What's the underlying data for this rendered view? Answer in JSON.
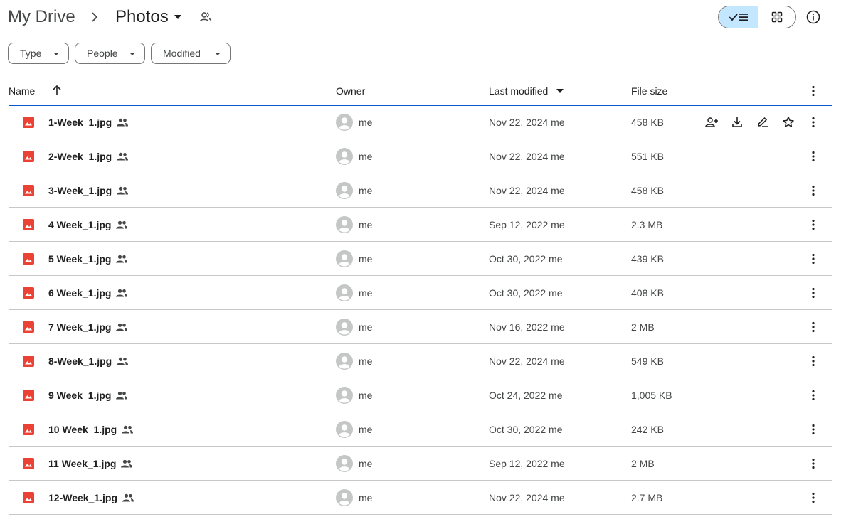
{
  "breadcrumb": {
    "root": "My Drive",
    "current": "Photos"
  },
  "icons": {
    "separator": "chevron-right-icon",
    "folder_menu": "caret-down-icon",
    "shared_folder": "people-outline-icon",
    "list_view": "check-list-icon",
    "grid_view": "grid-icon",
    "info": "info-icon"
  },
  "filters": {
    "type": "Type",
    "people": "People",
    "modified": "Modified"
  },
  "columns": {
    "name": "Name",
    "owner": "Owner",
    "last_modified": "Last modified",
    "file_size": "File size"
  },
  "colors": {
    "accent": "#0b57d0",
    "selected_toggle": "#c2e7ff",
    "image_file": "#ea4335"
  },
  "files": [
    {
      "name": "1-Week_1.jpg",
      "owner": "me",
      "modified": "Nov 22, 2024 me",
      "size": "458 KB"
    },
    {
      "name": "2-Week_1.jpg",
      "owner": "me",
      "modified": "Nov 22, 2024 me",
      "size": "551 KB"
    },
    {
      "name": "3-Week_1.jpg",
      "owner": "me",
      "modified": "Nov 22, 2024 me",
      "size": "458 KB"
    },
    {
      "name": "4 Week_1.jpg",
      "owner": "me",
      "modified": "Sep 12, 2022 me",
      "size": "2.3 MB"
    },
    {
      "name": "5 Week_1.jpg",
      "owner": "me",
      "modified": "Oct 30, 2022 me",
      "size": "439 KB"
    },
    {
      "name": "6 Week_1.jpg",
      "owner": "me",
      "modified": "Oct 30, 2022 me",
      "size": "408 KB"
    },
    {
      "name": "7 Week_1.jpg",
      "owner": "me",
      "modified": "Nov 16, 2022 me",
      "size": "2 MB"
    },
    {
      "name": "8-Week_1.jpg",
      "owner": "me",
      "modified": "Nov 22, 2024 me",
      "size": "549 KB"
    },
    {
      "name": "9 Week_1.jpg",
      "owner": "me",
      "modified": "Oct 24, 2022 me",
      "size": "1,005 KB"
    },
    {
      "name": "10 Week_1.jpg",
      "owner": "me",
      "modified": "Oct 30, 2022 me",
      "size": "242 KB"
    },
    {
      "name": "11 Week_1.jpg",
      "owner": "me",
      "modified": "Sep 12, 2022 me",
      "size": "2 MB"
    },
    {
      "name": "12-Week_1.jpg",
      "owner": "me",
      "modified": "Nov 22, 2024 me",
      "size": "2.7 MB"
    }
  ]
}
